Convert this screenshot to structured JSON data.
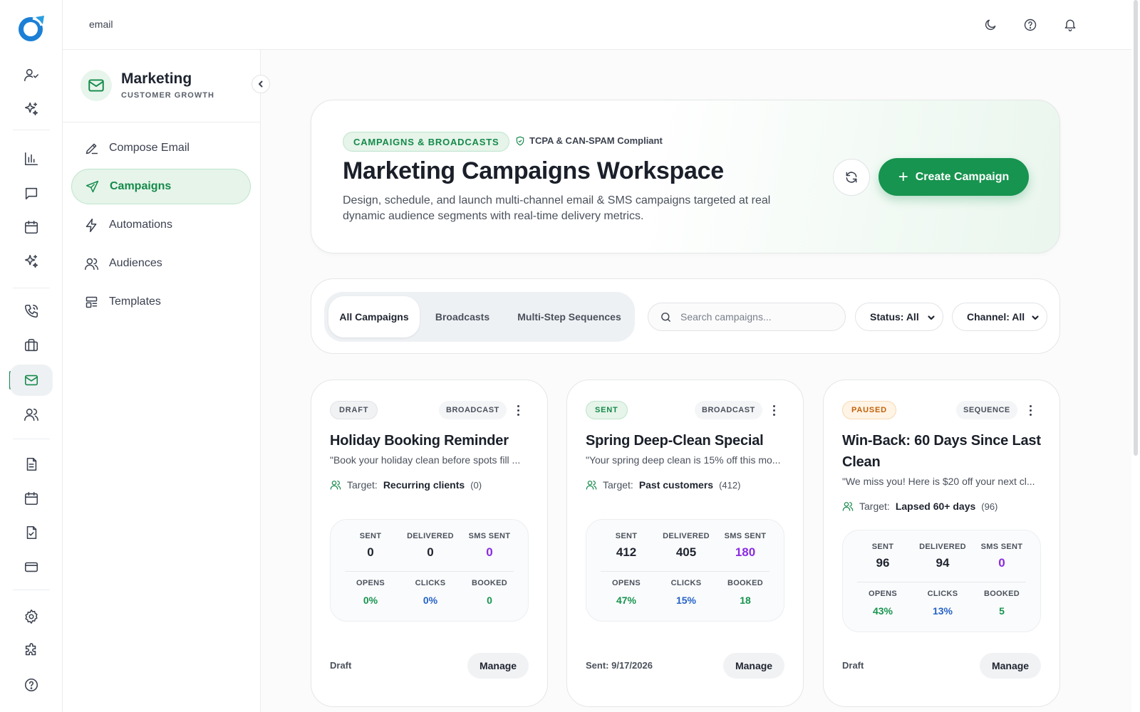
{
  "topbar": {
    "breadcrumb": "email"
  },
  "panel": {
    "title": "Marketing",
    "subtitle": "CUSTOMER GROWTH"
  },
  "nav": [
    {
      "label": "Compose Email",
      "icon": "pencil-icon"
    },
    {
      "label": "Campaigns",
      "icon": "send-icon",
      "active": true
    },
    {
      "label": "Automations",
      "icon": "bolt-icon"
    },
    {
      "label": "Audiences",
      "icon": "users-icon"
    },
    {
      "label": "Templates",
      "icon": "layout-icon"
    }
  ],
  "hero": {
    "tag": "CAMPAIGNS & BROADCASTS",
    "compliance": "TCPA & CAN-SPAM Compliant",
    "title": "Marketing Campaigns Workspace",
    "description": "Design, schedule, and launch multi-channel email & SMS campaigns targeted at real dynamic audience segments with real-time delivery metrics.",
    "create_label": "Create Campaign"
  },
  "filters": {
    "tabs": [
      "All Campaigns",
      "Broadcasts",
      "Multi-Step Sequences"
    ],
    "active_tab": "All Campaigns",
    "search_placeholder": "Search campaigns...",
    "status": "Status: All",
    "channel": "Channel: All"
  },
  "colors": {
    "accent": "#17944f",
    "accent_light": "#e6f4ea",
    "paused": "#c2620d",
    "sms": "#8a2be2",
    "clicks": "#2563c9"
  },
  "stat_labels": {
    "sent": "SENT",
    "delivered": "DELIVERED",
    "sms_sent": "SMS SENT",
    "opens": "OPENS",
    "clicks": "CLICKS",
    "booked": "BOOKED"
  },
  "target_label": "Target:",
  "manage_label": "Manage",
  "campaigns": [
    {
      "status": "DRAFT",
      "type": "BROADCAST",
      "title": "Holiday Booking Reminder",
      "preview": "\"Book your holiday clean before spots fill ...",
      "target": "Recurring clients",
      "count": "(0)",
      "sent": "0",
      "delivered": "0",
      "sms_sent": "0",
      "opens": "0%",
      "clicks": "0%",
      "booked": "0",
      "footer": "Draft"
    },
    {
      "status": "SENT",
      "type": "BROADCAST",
      "title": "Spring Deep-Clean Special",
      "preview": "\"Your spring deep clean is 15% off this mo...",
      "target": "Past customers",
      "count": "(412)",
      "sent": "412",
      "delivered": "405",
      "sms_sent": "180",
      "opens": "47%",
      "clicks": "15%",
      "booked": "18",
      "footer": "Sent: 9/17/2026"
    },
    {
      "status": "PAUSED",
      "type": "SEQUENCE",
      "title": "Win-Back: 60 Days Since Last Clean",
      "preview": "\"We miss you! Here is $20 off your next cl...",
      "target": "Lapsed 60+ days",
      "count": "(96)",
      "sent": "96",
      "delivered": "94",
      "sms_sent": "0",
      "opens": "43%",
      "clicks": "13%",
      "booked": "5",
      "footer": "Draft"
    }
  ]
}
